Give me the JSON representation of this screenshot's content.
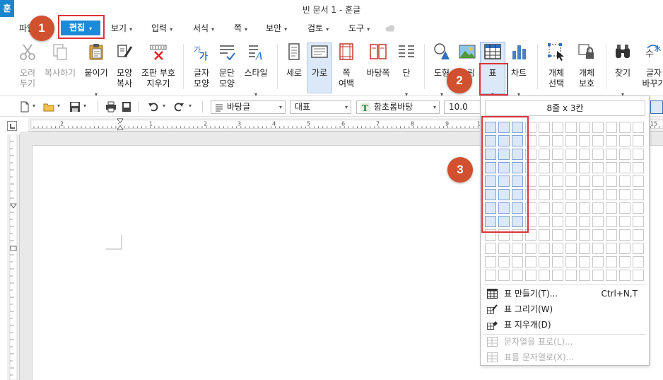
{
  "app": {
    "logo_text": "훈",
    "window_title": "빈 문서 1 - 훈글"
  },
  "menu": {
    "items": [
      {
        "label": "파일"
      },
      {
        "label": "편집"
      },
      {
        "label": "보기"
      },
      {
        "label": "입력"
      },
      {
        "label": "서식"
      },
      {
        "label": "쪽"
      },
      {
        "label": "보안"
      },
      {
        "label": "검토"
      },
      {
        "label": "도구"
      }
    ],
    "dropdown_arrow": "▾",
    "active_color": "#1b8ad8"
  },
  "ribbon": {
    "cut": {
      "label_1": "오려",
      "label_2": "두기"
    },
    "copy": {
      "label": "복사하기"
    },
    "paste": {
      "label": "붙이기"
    },
    "format_copy": {
      "label_1": "모양",
      "label_2": "복사"
    },
    "erase_marks": {
      "label_1": "조판 부호",
      "label_2": "지우기"
    },
    "char_shape": {
      "label_1": "글자",
      "label_2": "모양"
    },
    "para_shape": {
      "label_1": "문단",
      "label_2": "모양"
    },
    "style": {
      "label": "스타일"
    },
    "portrait": {
      "label": "세로"
    },
    "landscape": {
      "label": "가로"
    },
    "page_margin": {
      "label_1": "쪽",
      "label_2": "여백"
    },
    "background": {
      "label": "바탕쪽"
    },
    "columns": {
      "label": "단"
    },
    "shape": {
      "label": "도형"
    },
    "picture": {
      "label": "그림"
    },
    "table": {
      "label": "표"
    },
    "chart": {
      "label": "차트"
    },
    "object_select": {
      "label_1": "개체",
      "label_2": "선택"
    },
    "object_protect": {
      "label_1": "개체",
      "label_2": "보호"
    },
    "find": {
      "label": "찾기"
    },
    "replace": {
      "label_1": "글자",
      "label_2": "바꾸기"
    }
  },
  "toolbar": {
    "style_value": "바탕글",
    "outline_value": "대표",
    "font_value": "함초롬바탕",
    "font_size_value": "10.0"
  },
  "table_popup": {
    "grid_size_label": "8줄 x 3칸",
    "grid": {
      "rows": 12,
      "cols": 12,
      "selected_rows": 8,
      "selected_cols": 3
    },
    "items": [
      {
        "label": "표 만들기(T)...",
        "shortcut": "Ctrl+N,T",
        "enabled": true,
        "icon": "table-icon"
      },
      {
        "label": "표 그리기(W)",
        "enabled": true,
        "icon": "draw-table-icon"
      },
      {
        "label": "표 지우개(D)",
        "enabled": true,
        "icon": "eraser-icon"
      },
      {
        "label": "문자열을 표로(L)...",
        "enabled": false,
        "icon": "text-to-table-icon"
      },
      {
        "label": "표를 문자열로(X)...",
        "enabled": false,
        "icon": "table-to-text-icon"
      }
    ]
  },
  "callouts": {
    "badge_1": "1",
    "badge_2": "2",
    "badge_3": "3",
    "highlight_color": "#e0323a",
    "badge_color": "#d0502f"
  }
}
